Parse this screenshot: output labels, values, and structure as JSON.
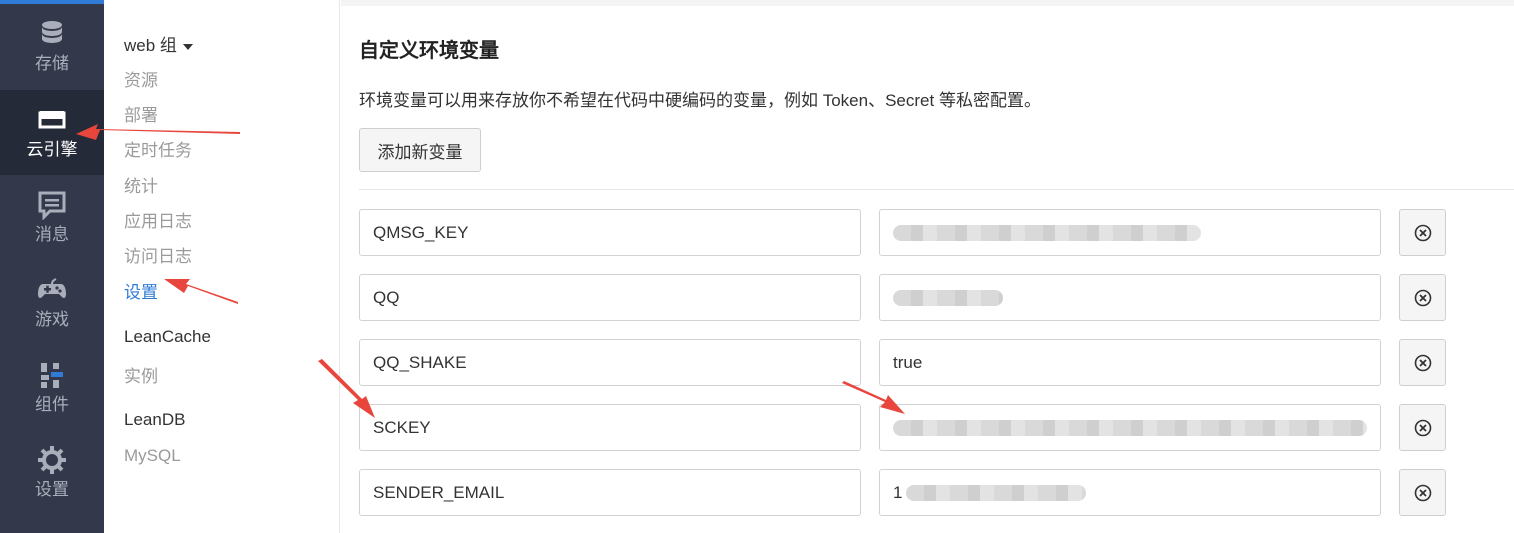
{
  "rail": {
    "items": [
      {
        "label": "存储",
        "icon": "database-icon"
      },
      {
        "label": "云引擎",
        "icon": "server-icon",
        "active": true
      },
      {
        "label": "消息",
        "icon": "message-icon"
      },
      {
        "label": "游戏",
        "icon": "gamepad-icon"
      },
      {
        "label": "组件",
        "icon": "components-icon"
      },
      {
        "label": "设置",
        "icon": "gear-icon"
      }
    ]
  },
  "subnav": {
    "group1": "web 组",
    "items1": [
      "资源",
      "部署",
      "定时任务",
      "统计",
      "应用日志",
      "访问日志",
      "设置"
    ],
    "group2": "LeanCache",
    "items2": [
      "实例"
    ],
    "group3": "LeanDB",
    "items3": [
      "MySQL"
    ]
  },
  "content": {
    "title": "自定义环境变量",
    "description": "环境变量可以用来存放你不希望在代码中硬编码的变量，例如 Token、Secret 等私密配置。",
    "add_button": "添加新变量",
    "variables": [
      {
        "key": "QMSG_KEY",
        "value": ""
      },
      {
        "key": "QQ",
        "value": ""
      },
      {
        "key": "QQ_SHAKE",
        "value": "true"
      },
      {
        "key": "SCKEY",
        "value": ""
      },
      {
        "key": "SENDER_EMAIL",
        "value": "1"
      }
    ]
  },
  "colors": {
    "rail_bg": "#33384b",
    "accent": "#2f7bd6",
    "arrow": "#e8453c"
  }
}
